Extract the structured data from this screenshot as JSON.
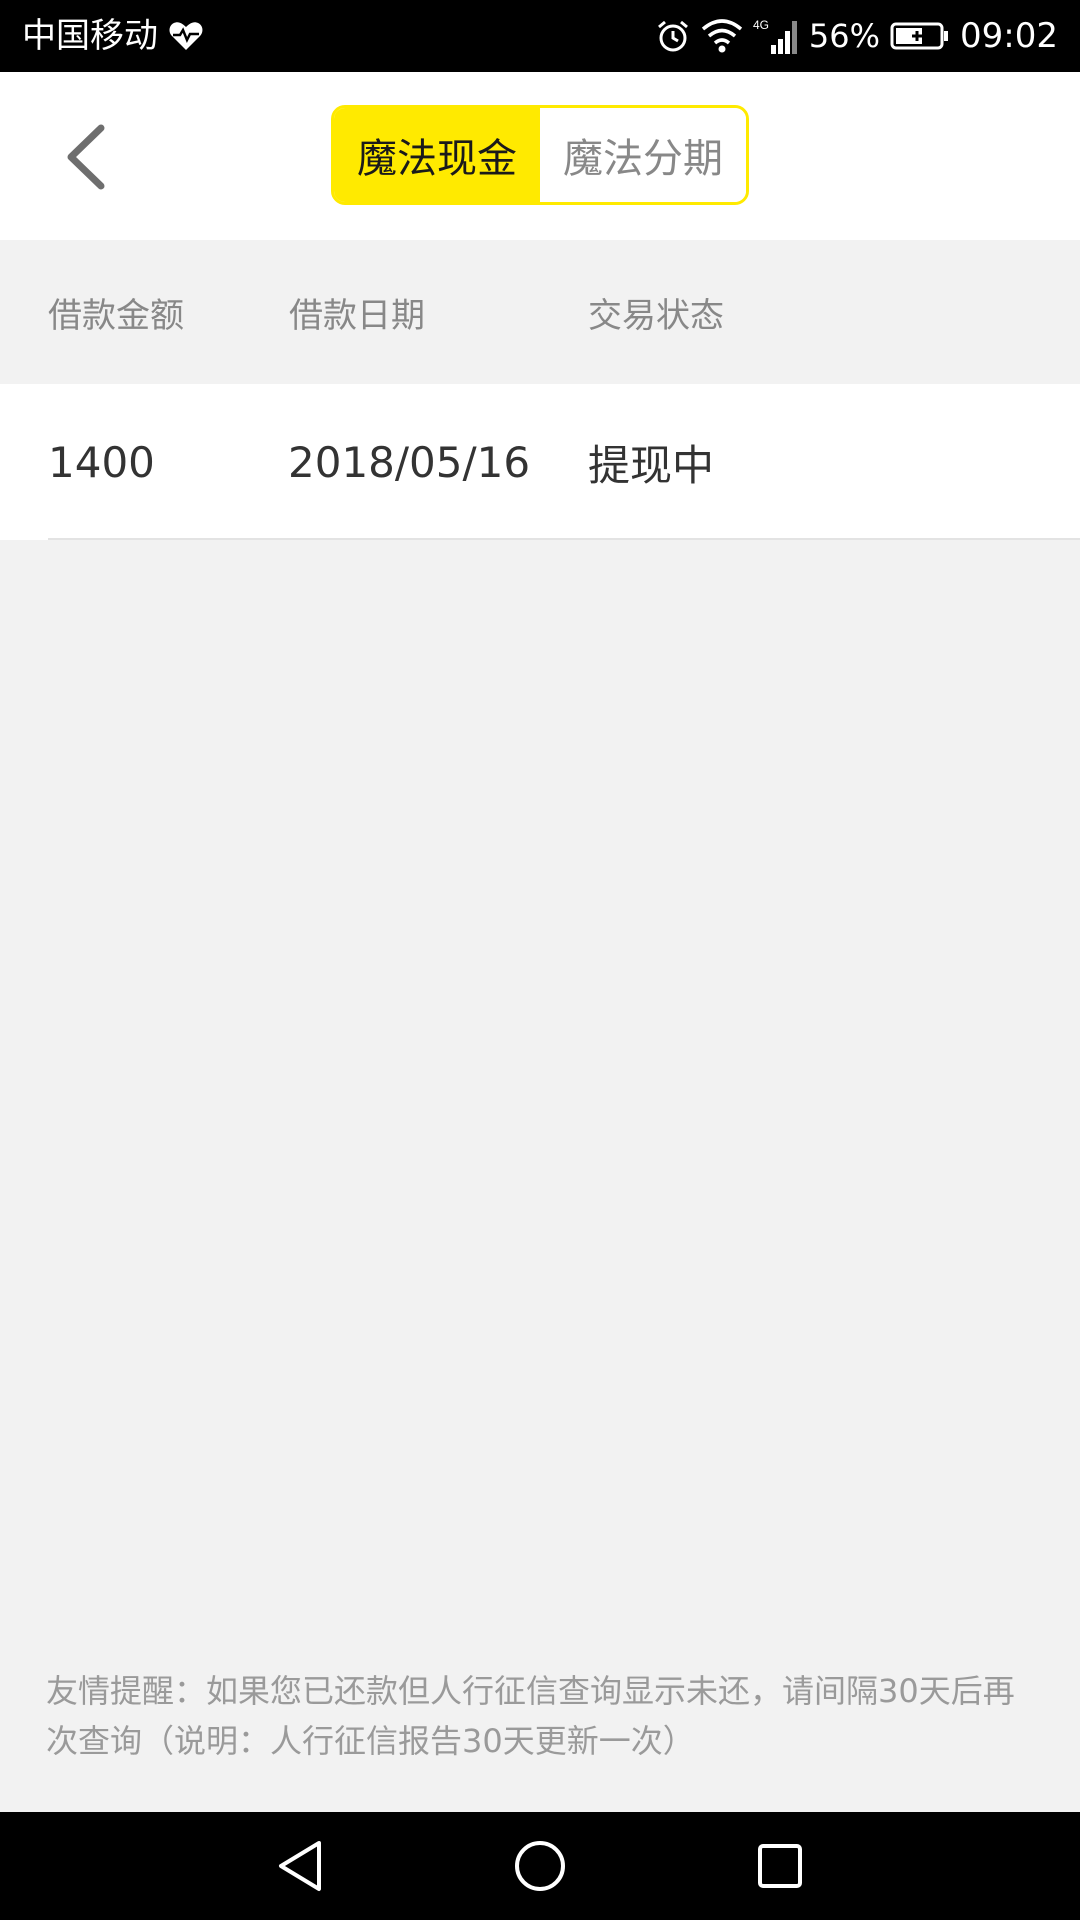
{
  "status_bar": {
    "carrier": "中国移动",
    "network": "4G",
    "battery": "56%",
    "time": "09:02",
    "icons": [
      "heart-pulse-icon",
      "alarm-icon",
      "wifi-icon",
      "signal-icon",
      "battery-charging-icon"
    ]
  },
  "header": {
    "back_icon": "chevron-left-icon",
    "tabs": [
      {
        "label": "魔法现金",
        "active": true
      },
      {
        "label": "魔法分期",
        "active": false
      }
    ]
  },
  "table": {
    "columns": [
      "借款金额",
      "借款日期",
      "交易状态"
    ],
    "rows": [
      {
        "amount": "1400",
        "date": "2018/05/16",
        "status": "提现中"
      }
    ]
  },
  "footer": {
    "note": "友情提醒：如果您已还款但人行征信查询显示未还，请间隔30天后再次查询（说明：人行征信报告30天更新一次）"
  },
  "nav_bar": {
    "buttons": [
      "back-triangle-icon",
      "home-circle-icon",
      "recents-square-icon"
    ]
  },
  "colors": {
    "accent": "#ffea00",
    "background": "#f2f2f2",
    "text_primary": "#333333",
    "text_secondary": "#888888"
  }
}
